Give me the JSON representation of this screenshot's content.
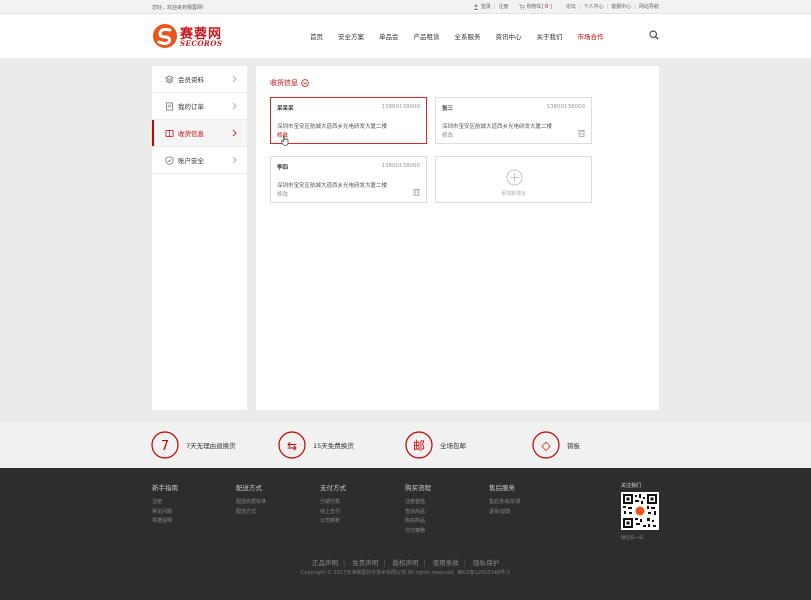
{
  "topbar": {
    "welcome": "您好，欢迎来到赛蓉网!",
    "login": "登录",
    "register": "注册",
    "cart_label": "购物车",
    "cart_count": "0",
    "links": [
      "论坛",
      "个人中心",
      "客服中心",
      "网站导航"
    ]
  },
  "header": {
    "logo_cn": "赛蓉网",
    "logo_en": "SECOROS",
    "nav": [
      "首页",
      "安全方案",
      "单品会",
      "产品租赁",
      "全系服务",
      "资讯中心",
      "关于我们",
      "市场合作"
    ],
    "active_nav": "市场合作"
  },
  "sidebar": {
    "items": [
      {
        "label": "会员资料",
        "icon": "stack-icon"
      },
      {
        "label": "我的订单",
        "icon": "order-icon"
      },
      {
        "label": "收货信息",
        "icon": "address-book-icon",
        "active": true
      },
      {
        "label": "账户安全",
        "icon": "shield-icon"
      }
    ]
  },
  "panel": {
    "title": "收货信息",
    "addresses": [
      {
        "name": "呆呆呆",
        "phone": "13800138000",
        "address": "深圳市宝安区航城大道西乡光电研发大厦二楼",
        "edit": "修改",
        "selected": true
      },
      {
        "name": "张三",
        "phone": "13800138000",
        "address": "深圳市宝安区航城大道西乡光电研发大厦二楼",
        "edit": "修改",
        "selected": false
      },
      {
        "name": "李四",
        "phone": "13800138000",
        "address": "深圳市宝安区航城大道西乡光电研发大厦二楼",
        "edit": "修改",
        "selected": false
      }
    ],
    "add_label": "添加新地址"
  },
  "services": [
    {
      "icon_text": "7",
      "label": "7天无理由退换货"
    },
    {
      "icon_text": "⇆",
      "label": "15天免费换货"
    },
    {
      "icon_text": "邮",
      "label": "全场包邮"
    },
    {
      "icon_text": "◇",
      "label": "铜板"
    }
  ],
  "footer": {
    "columns": [
      {
        "title": "新手指南",
        "links": [
          "注册",
          "常见问题",
          "票据说明"
        ]
      },
      {
        "title": "配送方式",
        "links": [
          "配送收费标准",
          "配送方式"
        ]
      },
      {
        "title": "支付方式",
        "links": [
          "分期付款",
          "线上支付",
          "公司转账"
        ]
      },
      {
        "title": "购买流程",
        "links": [
          "注册登陆",
          "查找商品",
          "购买商品",
          "交付策略"
        ]
      },
      {
        "title": "售后服务",
        "links": [
          "售后咨询/反馈",
          "退货/退款"
        ]
      }
    ],
    "follow_title": "关注我们",
    "qr_caption": "微信扫一扫",
    "bottom_links": [
      "正品声明",
      "免责声明",
      "版权声明",
      "使用条款",
      "隐私保护"
    ],
    "copyright": "Copyright © 2017天津赛蓉软件技术有限公司 All rights reserved. 津ICP备12003148号-2"
  },
  "colors": {
    "accent": "#c40000",
    "footer_bg": "#2d2d2d",
    "services_bg": "#f1f1f1"
  }
}
